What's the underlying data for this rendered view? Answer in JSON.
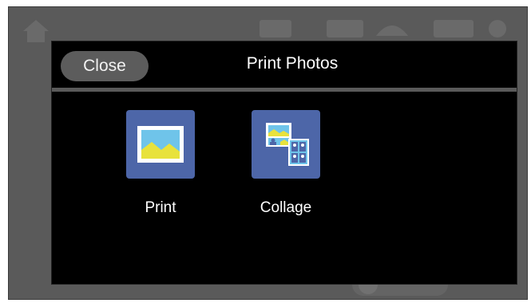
{
  "dialog": {
    "title": "Print Photos",
    "close_label": "Close"
  },
  "options": [
    {
      "label": "Print",
      "icon": "photo-icon"
    },
    {
      "label": "Collage",
      "icon": "collage-icon"
    }
  ],
  "colors": {
    "tile_blue": "#4d66a8",
    "dialog_bg": "#000000",
    "frame_gray": "#5a5a5a"
  }
}
